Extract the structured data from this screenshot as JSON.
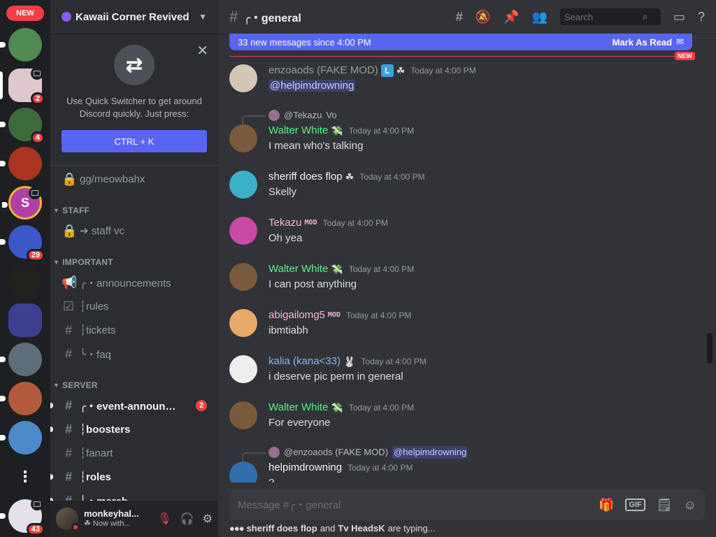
{
  "rail": {
    "new_pill": "NEW",
    "badges": {
      "s2": "2",
      "s3": "4",
      "s6": "29",
      "s12": "43"
    },
    "s5_letter": "S",
    "more": "⋮"
  },
  "server": {
    "name": "Kawaii Corner Revived"
  },
  "quick_switcher": {
    "text_line1": "Use Quick Switcher to get around",
    "text_line2": "Discord quickly. Just press:",
    "button": "CTRL + K"
  },
  "channels": [
    {
      "category": null,
      "items": [
        {
          "icon": "lock-icon",
          "label": "gg/meowbahx"
        }
      ]
    },
    {
      "category": "STAFF",
      "items": [
        {
          "icon": "lock-icon",
          "label": "➔ staff vc"
        }
      ]
    },
    {
      "category": "IMPORTANT",
      "items": [
        {
          "icon": "megaphone-icon",
          "label": "╭・announcements"
        },
        {
          "icon": "rules-icon",
          "label": "┆rules"
        },
        {
          "icon": "hash-icon",
          "label": "┆tickets"
        },
        {
          "icon": "hash-icon",
          "label": "╰・faq"
        }
      ]
    },
    {
      "category": "SERVER",
      "items": [
        {
          "icon": "hash-icon",
          "label": "╭・event-announce...",
          "badge": "2",
          "unread": true
        },
        {
          "icon": "hash-icon",
          "label": "┆boosters",
          "unread": true
        },
        {
          "icon": "hash-icon",
          "label": "┆fanart"
        },
        {
          "icon": "hash-icon",
          "label": "┆roles",
          "unread": true
        },
        {
          "icon": "hash-icon",
          "label": "╰・merch",
          "unread": true
        }
      ]
    }
  ],
  "user": {
    "name": "monkeyhal...",
    "status": "Now with..."
  },
  "channel": {
    "title": "╭・general"
  },
  "search": {
    "placeholder": "Search"
  },
  "banner": {
    "text": "33 new messages since 4:00 PM",
    "mark": "Mark As Read"
  },
  "new_tag": "NEW",
  "messages": [
    {
      "name": "enzoaods (FAKE MOD)",
      "name_color": "#949ba4",
      "badge": "L",
      "emoji": "☘",
      "time": "Today at 4:00 PM",
      "body": "@helpimdrowning",
      "mention": true,
      "avatar_color": "#d6c6b4"
    },
    {
      "reply": {
        "name": "@Tekazu",
        "text": "Vo"
      },
      "name": "Walter White",
      "name_color": "#57f287",
      "emoji": "💸",
      "time": "Today at 4:00 PM",
      "body": "I mean who's talking",
      "avatar_color": "#7a5a3a"
    },
    {
      "name": "sheriff does flop",
      "name_color": "#f2f3f5",
      "emoji": "☘",
      "time": "Today at 4:00 PM",
      "body": "Skelly",
      "avatar_color": "#3bb0c9"
    },
    {
      "name": "Tekazu",
      "name_color": "#f2b8d8",
      "tag": "MOD",
      "time": "Today at 4:00 PM",
      "body": "Oh yea",
      "avatar_color": "#c94aa6"
    },
    {
      "name": "Walter White",
      "name_color": "#57f287",
      "emoji": "💸",
      "time": "Today at 4:00 PM",
      "body": "I can post anything",
      "avatar_color": "#7a5a3a"
    },
    {
      "name": "abigailomg5",
      "name_color": "#f2b8d8",
      "tag": "MOD",
      "time": "Today at 4:00 PM",
      "body": "ibmtiabh",
      "avatar_color": "#e8a96a"
    },
    {
      "name": "kalia (kana<33)",
      "name_color": "#7fb8f0",
      "emoji": "🐰",
      "time": "Today at 4:00 PM",
      "body": "i deserve pic perm in general",
      "avatar_color": "#eeeeee"
    },
    {
      "name": "Walter White",
      "name_color": "#57f287",
      "emoji": "💸",
      "time": "Today at 4:00 PM",
      "body": "For everyone",
      "avatar_color": "#7a5a3a"
    },
    {
      "reply": {
        "name": "@enzoaods (FAKE MOD)",
        "text": "@helpimdrowning",
        "mention": true
      },
      "name": "helpimdrowning",
      "name_color": "#f2f3f5",
      "time": "Today at 4:00 PM",
      "body": "?",
      "avatar_color": "#2f6fb0"
    }
  ],
  "composer": {
    "placeholder": "Message #╭・general",
    "gif": "GIF"
  },
  "typing": {
    "user1": "sheriff does flop",
    "and": "and",
    "user2": "Tv HeadsK",
    "suffix": "are typing..."
  },
  "colors": {
    "accent": "#5865f2",
    "danger": "#f23f43",
    "online_green": "#57f287"
  }
}
